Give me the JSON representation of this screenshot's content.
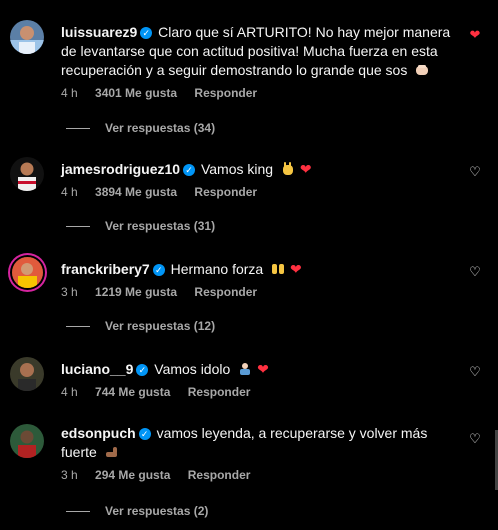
{
  "comments": [
    {
      "user": "luissuarez9",
      "text": "Claro que sí ARTURITO! No hay mejor manera de levantarse que con actitud positiva! Mucha fuerza en esta recuperación y a seguir demostrando lo grande que sos",
      "emoji": "fist-bump-emoji",
      "time": "4 h",
      "likes": "3401 Me gusta",
      "reply": "Responder",
      "liked": true,
      "view_replies": "Ver respuestas (34)"
    },
    {
      "user": "jamesrodriguez10",
      "text": "Vamos king",
      "emoji": "waving-hands-emoji",
      "heart": "❤",
      "time": "4 h",
      "likes": "3894 Me gusta",
      "reply": "Responder",
      "liked": false,
      "view_replies": "Ver respuestas (31)"
    },
    {
      "user": "franckribery7",
      "text": "Hermano forza",
      "emoji": "raised-hands-emoji",
      "heart": "❤",
      "time": "3 h",
      "likes": "1219 Me gusta",
      "reply": "Responder",
      "liked": false,
      "view_replies": "Ver respuestas (12)"
    },
    {
      "user": "luciano__9",
      "text": "Vamos idolo",
      "emoji": "person-bowing-emoji",
      "heart": "❤",
      "time": "4 h",
      "likes": "744 Me gusta",
      "reply": "Responder",
      "liked": false
    },
    {
      "user": "edsonpuch",
      "text": "vamos leyenda, a recuperarse y volver más fuerte",
      "emoji": "flexed-biceps-emoji",
      "time": "3 h",
      "likes": "294 Me gusta",
      "reply": "Responder",
      "liked": false,
      "view_replies": "Ver respuestas (2)"
    }
  ],
  "icons": {
    "like": "heart-icon",
    "verified": "verified-badge-icon"
  },
  "colors": {
    "background": "#000000",
    "text": "#f5f5f5",
    "muted": "#a8a8a8",
    "liked": "#ff3040",
    "verified": "#0095f6"
  }
}
